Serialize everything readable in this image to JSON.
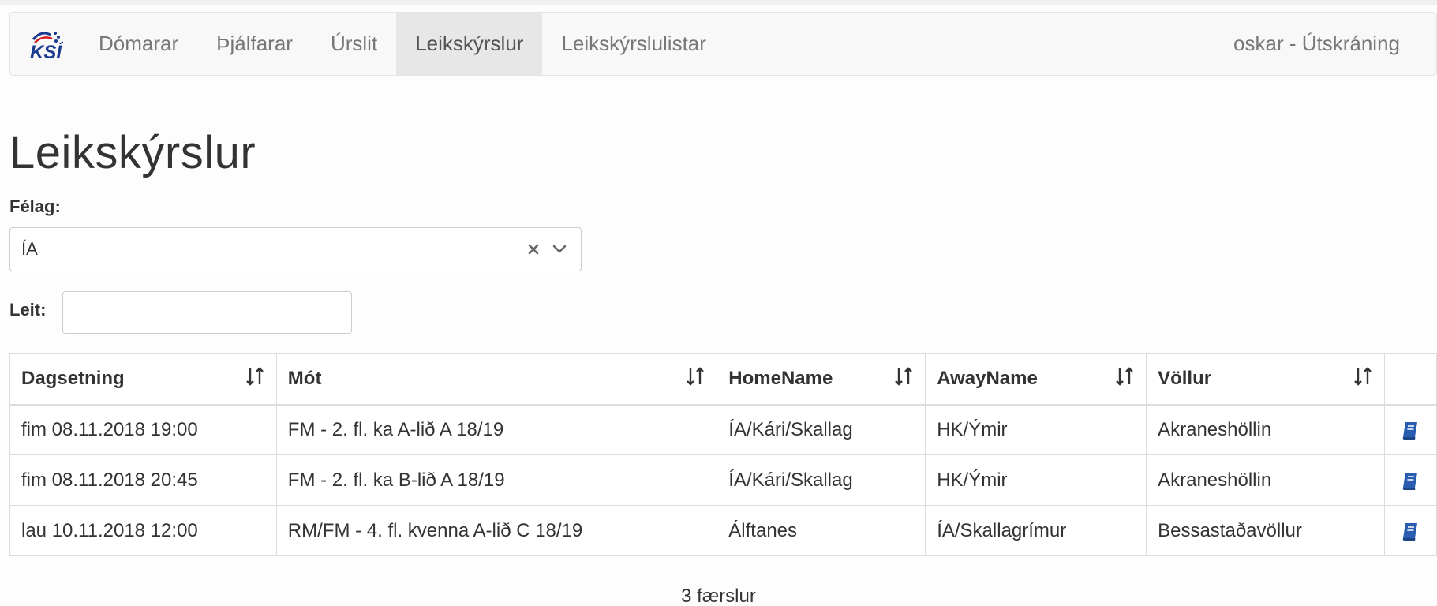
{
  "nav": {
    "brand": "KSÍ",
    "items": [
      {
        "label": "Dómarar",
        "active": false
      },
      {
        "label": "Þjálfarar",
        "active": false
      },
      {
        "label": "Úrslit",
        "active": false
      },
      {
        "label": "Leikskýrslur",
        "active": true
      },
      {
        "label": "Leikskýrslulistar",
        "active": false
      }
    ],
    "user": "oskar - Útskráning"
  },
  "page": {
    "title": "Leikskýrslur",
    "felag_label": "Félag:",
    "felag_value": "ÍA",
    "leit_label": "Leit:",
    "leit_value": ""
  },
  "table": {
    "headers": [
      "Dagsetning",
      "Mót",
      "HomeName",
      "AwayName",
      "Völlur"
    ],
    "rows": [
      [
        "fim 08.11.2018 19:00",
        "FM - 2. fl. ka A-lið A 18/19",
        "ÍA/Kári/Skallag",
        "HK/Ýmir",
        "Akraneshöllin"
      ],
      [
        "fim 08.11.2018 20:45",
        "FM - 2. fl. ka B-lið A 18/19",
        "ÍA/Kári/Skallag",
        "HK/Ýmir",
        "Akraneshöllin"
      ],
      [
        "lau 10.11.2018 12:00",
        "RM/FM - 4. fl. kvenna A-lið C 18/19",
        "Álftanes",
        "ÍA/Skallagrímur",
        "Bessastaðavöllur"
      ]
    ]
  },
  "footer": {
    "count_text": "3 færslur"
  },
  "colors": {
    "brand_blue": "#1a3a8f",
    "brand_red": "#d71920",
    "book_blue": "#2a5db0"
  }
}
